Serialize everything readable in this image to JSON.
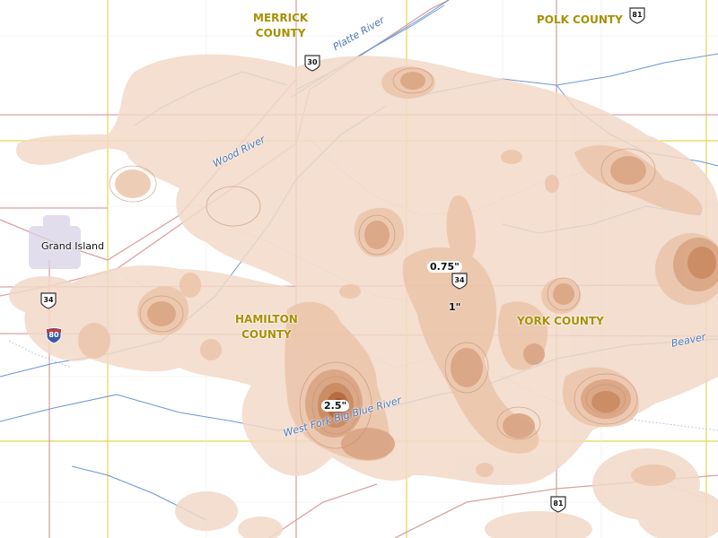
{
  "map": {
    "counties": {
      "merrick": "MERRICK\nCOUNTY",
      "polk": "POLK COUNTY",
      "hamilton": "HAMILTON\nCOUNTY",
      "york": "YORK COUNTY"
    },
    "cities": {
      "grand_island": "Grand Island"
    },
    "rivers": {
      "platte": "Platte River",
      "wood": "Wood River",
      "west_fork_big_blue": "West Fork Big Blue River",
      "beaver": "Beaver"
    },
    "highways": {
      "us30": "30",
      "us81_north": "81",
      "us81_south": "81",
      "us34_east": "34",
      "us34_west": "34",
      "i80": "80"
    },
    "rainfall_labels": {
      "peak": "2.5\"",
      "mid": "0.75\"",
      "one_inch": "1\""
    },
    "colors": {
      "rain_light": "#f2d9c8",
      "rain_medium": "#e3b597",
      "rain_heavy": "#c98a62",
      "rain_peak": "#a85a33",
      "county_line": "#e6d54a",
      "road": "#d99a9a",
      "river": "#6b96d6",
      "county_label": "#a79000"
    },
    "icons": {
      "us_highway": "us-highway-shield-icon",
      "interstate": "interstate-shield-icon"
    }
  }
}
